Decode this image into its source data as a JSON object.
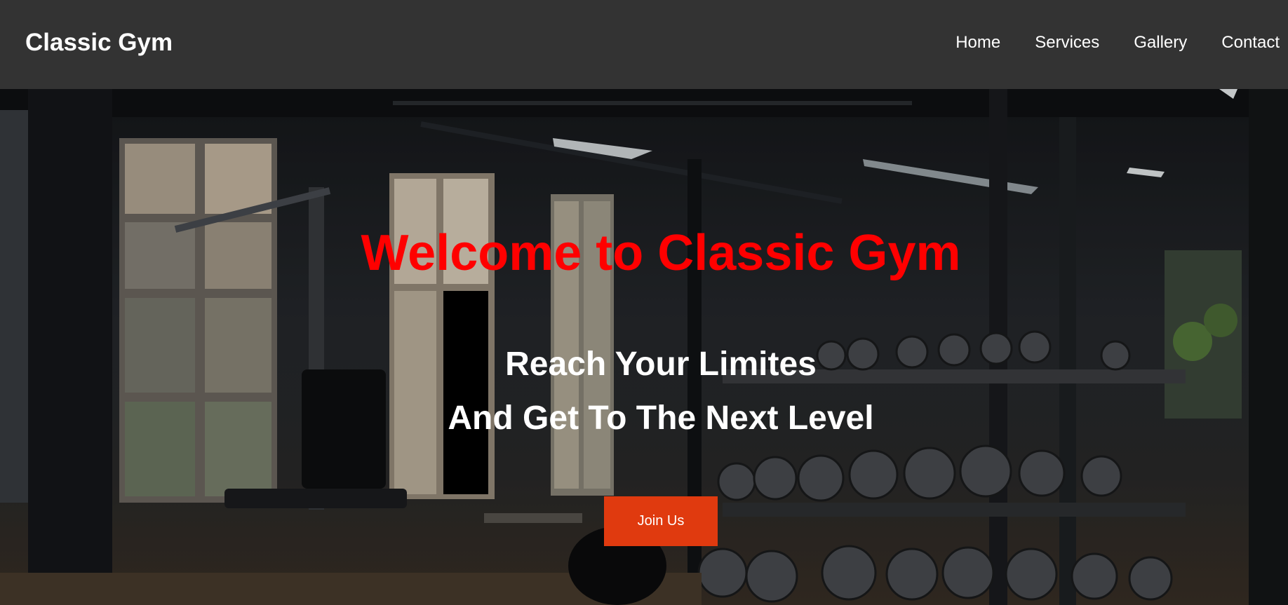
{
  "navbar": {
    "brand": "Classic Gym",
    "links": [
      "Home",
      "Services",
      "Gallery",
      "Contact"
    ]
  },
  "hero": {
    "title": "Welcome to Classic Gym",
    "tagline_line1": "Reach Your Limites",
    "tagline_line2": "And Get To The Next Level",
    "cta_label": "Join Us"
  },
  "colors": {
    "navbar_bg": "#333333",
    "title_red": "#ff0000",
    "cta_orange": "#e03a0f",
    "text_white": "#ffffff"
  }
}
